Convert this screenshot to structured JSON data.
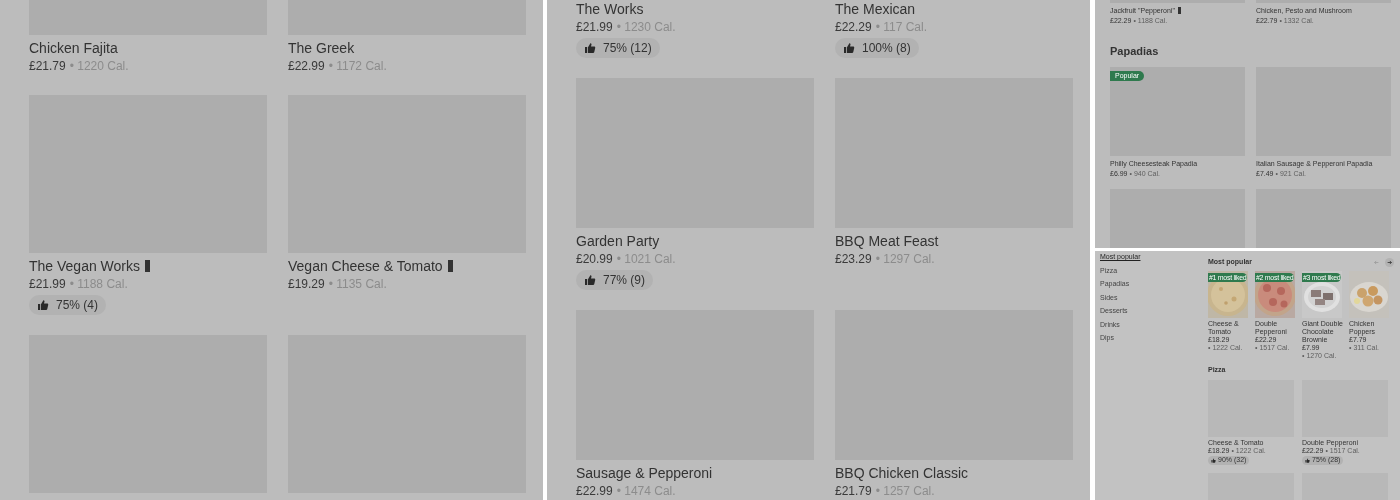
{
  "panel_1": {
    "cards": [
      {
        "kind": "item",
        "name": "Chicken Fajita",
        "vegan": false,
        "price": "£21.79",
        "calories": "• 1220 Cal."
      },
      {
        "kind": "item",
        "name": "The Greek",
        "vegan": false,
        "price": "£22.99",
        "calories": "• 1172 Cal."
      },
      {
        "kind": "item",
        "name": "The Vegan Works",
        "vegan": true,
        "price": "£21.99",
        "calories": "• 1188 Cal.",
        "rating": "75% (4)"
      },
      {
        "kind": "item",
        "name": "Vegan Cheese & Tomato",
        "vegan": true,
        "price": "£19.29",
        "calories": "• 1135 Cal."
      },
      {
        "kind": "image_only"
      },
      {
        "kind": "image_only"
      }
    ]
  },
  "panel_2": {
    "cards": [
      {
        "kind": "text_only",
        "name": "The Works",
        "vegan": false,
        "price": "£21.99",
        "calories": "• 1230 Cal.",
        "rating": "75% (12)"
      },
      {
        "kind": "text_only",
        "name": "The Mexican",
        "vegan": false,
        "price": "£22.29",
        "calories": "• 117 Cal.",
        "rating": "100% (8)"
      },
      {
        "kind": "item",
        "name": "Garden Party",
        "vegan": false,
        "price": "£20.99",
        "calories": "• 1021 Cal.",
        "rating": "77% (9)"
      },
      {
        "kind": "item",
        "name": "BBQ Meat Feast",
        "vegan": false,
        "price": "£23.29",
        "calories": "• 1297 Cal."
      },
      {
        "kind": "item",
        "name": "Sausage & Pepperoni",
        "vegan": false,
        "price": "£22.99",
        "calories": "• 1474 Cal."
      },
      {
        "kind": "item",
        "name": "BBQ Chicken Classic",
        "vegan": false,
        "price": "£21.79",
        "calories": "• 1257 Cal."
      }
    ]
  },
  "panel_3": {
    "sections": [
      {
        "cards": [
          {
            "kind": "item",
            "name": "Jackfruit \"Pepperoni\"",
            "vegan": true,
            "price": "£22.29",
            "calories": "• 1188 Cal."
          },
          {
            "kind": "item",
            "name": "Chicken, Pesto and Mushroom",
            "vegan": false,
            "price": "£22.79",
            "calories": "• 1332 Cal."
          }
        ]
      },
      {
        "title": "Papadias",
        "cards": [
          {
            "kind": "item",
            "name": "Philly Cheesesteak Papadia",
            "vegan": false,
            "badge": "Popular",
            "price": "£6.99",
            "calories": "• 940 Cal."
          },
          {
            "kind": "item",
            "name": "Italian Sausage & Pepperoni Papadia",
            "vegan": false,
            "price": "£7.49",
            "calories": "• 921 Cal."
          },
          {
            "kind": "image_only"
          },
          {
            "kind": "image_only"
          }
        ]
      }
    ]
  },
  "panel_4": {
    "sidebar": [
      {
        "label": "Most popular",
        "selected": true
      },
      {
        "label": "Pizza",
        "selected": false
      },
      {
        "label": "Papadias",
        "selected": false
      },
      {
        "label": "Sides",
        "selected": false
      },
      {
        "label": "Desserts",
        "selected": false
      },
      {
        "label": "Drinks",
        "selected": false
      },
      {
        "label": "Dips",
        "selected": false
      }
    ],
    "most_popular": {
      "title": "Most popular",
      "previous_disabled": true,
      "next_disabled": false,
      "items": [
        {
          "name": "Cheese & Tomato",
          "badge": "#1 most liked",
          "price": "£18.29",
          "calories": "• 1222 Cal."
        },
        {
          "name": "Double Pepperoni",
          "badge": "#2 most liked",
          "price": "£22.29",
          "calories": "• 1517 Cal."
        },
        {
          "name": "Giant Double Chocolate Brownie",
          "badge": "#3 most liked",
          "price": "£7.99",
          "calories": "• 1270 Cal."
        },
        {
          "name": "Chicken Poppers",
          "price": "£7.79",
          "calories": "• 311 Cal."
        }
      ]
    },
    "pizza": {
      "title": "Pizza",
      "cards": [
        {
          "kind": "item",
          "name": "Cheese & Tomato",
          "price": "£18.29",
          "calories": "• 1222 Cal.",
          "rating": "90% (32)"
        },
        {
          "kind": "item",
          "name": "Double Pepperoni",
          "price": "£22.29",
          "calories": "• 1517 Cal.",
          "rating": "75% (28)"
        },
        {
          "kind": "image_only"
        },
        {
          "kind": "image_only"
        }
      ]
    }
  }
}
